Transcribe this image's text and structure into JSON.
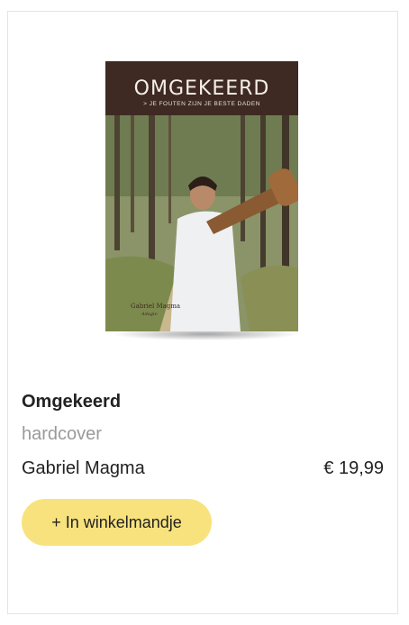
{
  "product": {
    "cover": {
      "title": "OMGEKEERD",
      "subtitle": "> JE FOUTEN ZIJN JE BESTE DADEN",
      "author": "Gabriel Magma",
      "imprint": "Adagio"
    },
    "title": "Omgekeerd",
    "format": "hardcover",
    "author": "Gabriel Magma",
    "price": "€ 19,99",
    "cart_button_label": "+ In winkelmandje"
  },
  "colors": {
    "button_bg": "#f8e27d",
    "cover_band": "#3e2a22",
    "muted_text": "#9a9a9a"
  }
}
